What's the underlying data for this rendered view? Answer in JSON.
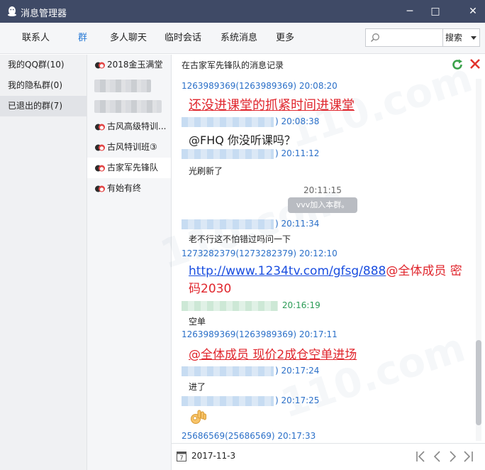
{
  "window": {
    "title": "消息管理器",
    "minimize": "─",
    "maximize": "□",
    "close": "✕"
  },
  "nav": {
    "tabs": [
      {
        "label": "联系人"
      },
      {
        "label": "群"
      },
      {
        "label": "多人聊天"
      },
      {
        "label": "临时会话"
      },
      {
        "label": "系统消息"
      },
      {
        "label": "更多"
      }
    ],
    "active_index": 1,
    "search_placeholder": "",
    "search_button": "搜索"
  },
  "categories": [
    {
      "label": "我的QQ群(10)"
    },
    {
      "label": "我的隐私群(0)"
    },
    {
      "label": "已退出的群(7)"
    }
  ],
  "groups": [
    {
      "label": "2018金玉满堂",
      "blurred": false
    },
    {
      "label": "",
      "blurred": true
    },
    {
      "label": "",
      "blurred": true
    },
    {
      "label": "古风高级特训...",
      "blurred": false
    },
    {
      "label": "古风特训班③",
      "blurred": false
    },
    {
      "label": "古家军先锋队",
      "blurred": false
    },
    {
      "label": "有始有终",
      "blurred": false
    }
  ],
  "messages_panel": {
    "header": "在古家军先锋队的消息记录",
    "m1_meta": "1263989369(1263989369) 20:08:20",
    "m1_text": "还没进课堂的抓紧时间进课堂",
    "m2_meta": ") 20:08:38",
    "m2_text": "@FHQ  你没听课吗？",
    "m3_meta": ") 20:11:12",
    "m3_text": "光刷新了",
    "sys_time": "20:11:15",
    "sys_text": "vvv加入本群。",
    "m4_meta": ") 20:11:34",
    "m4_text": "老不行这不怕错过吗问一下",
    "m5_meta": "1273282379(1273282379) 20:12:10",
    "m5_link": "http://www.1234tv.com/gfsg/888",
    "m5_rest": "@全体成员 密码2030",
    "m6_meta": " 20:16:19",
    "m6_text": "空单",
    "m7_meta": "1263989369(1263989369) 20:17:11",
    "m7_text": "@全体成员 现价2成仓空单进场",
    "m8_meta": ") 20:17:24",
    "m8_text": "进了",
    "m9_meta": ") 20:17:25",
    "m10_meta": "25686569(25686569) 20:17:33",
    "date": "2017-11-3"
  }
}
